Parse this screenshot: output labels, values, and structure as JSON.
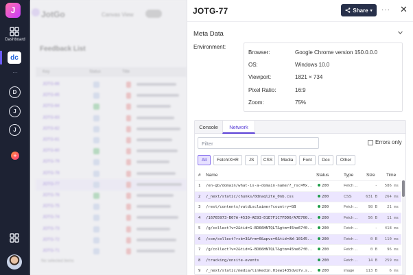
{
  "rail": {
    "logo_letter": "J",
    "dashboard_label": "Dashboard",
    "workspace_badge": "dc",
    "more_dots": "···",
    "circle_items": [
      "D",
      "J",
      "J"
    ]
  },
  "background": {
    "brand": "JotGo",
    "canvas_view_label": "Canvas View",
    "list_title": "Feedback List",
    "header": [
      "Key",
      "Status",
      "Title"
    ],
    "row_keys": [
      "JOTG-86",
      "JOTG-85",
      "JOTG-84",
      "JOTG-83",
      "JOTG-82",
      "JOTG-81",
      "JOTG-80",
      "JOTG-79",
      "JOTG-78",
      "JOTG-77",
      "JOTG-76",
      "JOTG-75",
      "JOTG-74",
      "JOTG-73",
      "JOTG-72",
      "JOTG-71"
    ],
    "footer": "No selected items"
  },
  "panel": {
    "title": "JOTG-77",
    "share_label": "Share",
    "more": "···",
    "close": "✕",
    "meta_title": "Meta Data",
    "env_label": "Environment:",
    "environment": [
      {
        "key": "Browser:",
        "value": "Google Chrome version 150.0.0.0"
      },
      {
        "key": "OS:",
        "value": "Windows 10.0"
      },
      {
        "key": "Viewport:",
        "value": "1821 × 734"
      },
      {
        "key": "Pixel Ratio:",
        "value": "16:9"
      },
      {
        "key": "Zoom:",
        "value": "75%"
      }
    ]
  },
  "network": {
    "tabs": [
      "Console",
      "Network"
    ],
    "active_tab": "Network",
    "filter_placeholder": "Filter",
    "errors_only_label": "Errors only",
    "chips": [
      "All",
      "Fetch/XHR",
      "JS",
      "CSS",
      "Media",
      "Font",
      "Doc",
      "Other"
    ],
    "active_chip": "All",
    "columns": [
      "#",
      "Name",
      "Status",
      "Type",
      "Size",
      "Time"
    ],
    "rows": [
      {
        "n": "1",
        "name": "/en-gb/domain/what-is-a-domain-name/?_rsc=Mx...",
        "status": "200",
        "type": "Fetch ...",
        "size": "-",
        "time": "586 ms"
      },
      {
        "n": "2",
        "name": "/_next/static/chunks/0dnaql2te_0nb.css",
        "status": "200",
        "type": "CSS",
        "size": "631 B",
        "time": "264 ms"
      },
      {
        "n": "3",
        "name": "/rest/contents/vatdisclaimer?country=GB",
        "status": "200",
        "type": "Fetch ...",
        "size": "98 B",
        "time": "21 ms"
      },
      {
        "n": "4",
        "name": "/16765973-B67A-4530-AE93-D1E7F1C7FDD0/A7E700...",
        "status": "200",
        "type": "Fetch ...",
        "size": "56 B",
        "time": "11 ms"
      },
      {
        "n": "5",
        "name": "/g/collect?v=2&tid=G-BD66HNTQLT&gtm=45he67f0...",
        "status": "200",
        "type": "Fetch ...",
        "size": "-",
        "time": "418 ms"
      },
      {
        "n": "6",
        "name": "/ccm/collect?rcb=3&frm=0&apvc=0&tid=AW-10145...",
        "status": "200",
        "type": "Fetch ...",
        "size": "0 B",
        "time": "110 ms"
      },
      {
        "n": "7",
        "name": "/g/collect?v=2&tid=G-BD66HNTQLT&gtm=45he67f0...",
        "status": "200",
        "type": "Fetch ...",
        "size": "0 B",
        "time": "96 ms"
      },
      {
        "n": "8",
        "name": "/tracking/onsite-events",
        "status": "200",
        "type": "Fetch ...",
        "size": "14 B",
        "time": "259 ms"
      },
      {
        "n": "9",
        "name": "/_next/static/media/linkedin.01ew1435dvo7v.s...",
        "status": "200",
        "type": "image",
        "size": "113 B",
        "time": "6 ms"
      }
    ],
    "highlighted_rows": [
      2,
      4,
      6,
      8
    ],
    "status_color": "#1f9d4a",
    "accent": "#5a3fd6"
  }
}
